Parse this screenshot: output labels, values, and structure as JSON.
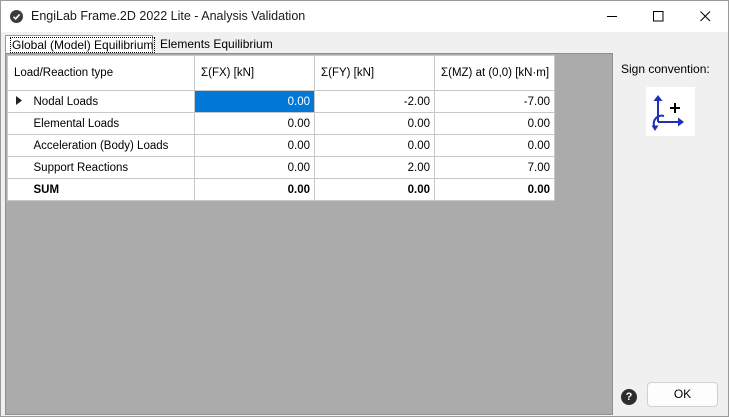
{
  "window": {
    "title": "EngiLab Frame.2D 2022 Lite - Analysis Validation"
  },
  "tabs": [
    {
      "label": "Global (Model) Equilibrium",
      "active": true
    },
    {
      "label": "Elements Equilibrium",
      "active": false
    }
  ],
  "table": {
    "headers": {
      "type": "Load/Reaction type",
      "fx": "Σ(FX) [kN]",
      "fy": "Σ(FY) [kN]",
      "mz": "Σ(MZ) at (0,0) [kN·m]"
    },
    "rows": [
      {
        "type": "Nodal Loads",
        "fx": "0.00",
        "fy": "-2.00",
        "mz": "-7.00"
      },
      {
        "type": "Elemental Loads",
        "fx": "0.00",
        "fy": "0.00",
        "mz": "0.00"
      },
      {
        "type": "Acceleration (Body) Loads",
        "fx": "0.00",
        "fy": "0.00",
        "mz": "0.00"
      },
      {
        "type": "Support Reactions",
        "fx": "0.00",
        "fy": "2.00",
        "mz": "7.00"
      },
      {
        "type": "SUM",
        "fx": "0.00",
        "fy": "0.00",
        "mz": "0.00"
      }
    ]
  },
  "side_panel": {
    "sign_convention_label": "Sign convention:",
    "help_label": "?",
    "ok_label": "OK"
  },
  "colors": {
    "selection": "#0078d7",
    "grid_background": "#ababab",
    "sign_arrow": "#1f2fb8"
  },
  "icons": {
    "app": "app-check-icon",
    "minimize": "minimize-icon",
    "maximize": "maximize-icon",
    "close": "close-icon",
    "row_indicator": "current-row-arrow-icon",
    "sign_convention": "sign-convention-axes-icon",
    "help": "help-icon"
  }
}
